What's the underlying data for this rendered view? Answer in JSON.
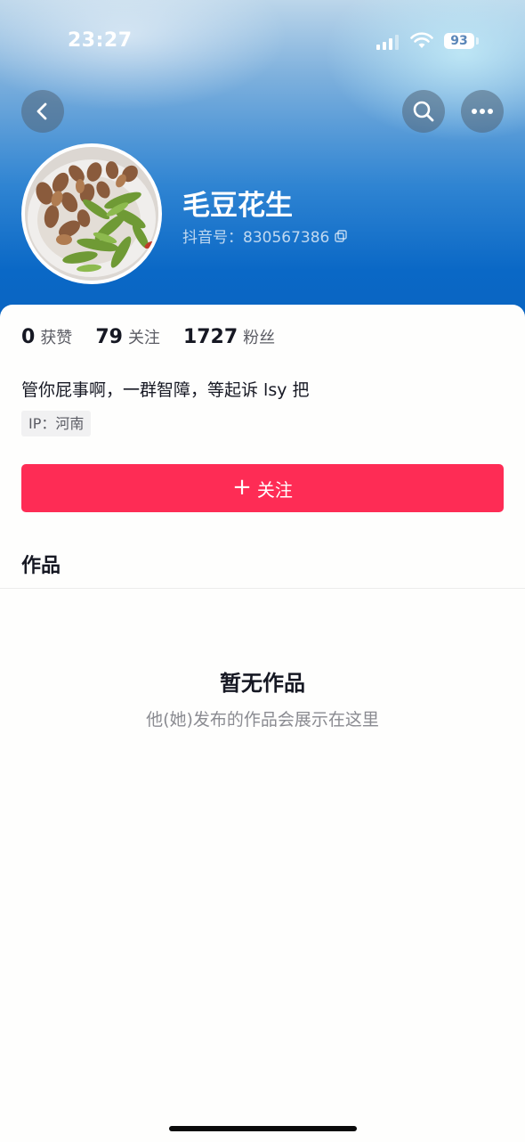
{
  "status_bar": {
    "time": "23:27",
    "battery": "93"
  },
  "profile": {
    "nickname": "毛豆花生",
    "douyin_id": "抖音号：830567386",
    "bio": "管你屁事啊，一群智障，等起诉 lsy 把",
    "ip": "IP：河南"
  },
  "stats": [
    {
      "value": "0",
      "label": "获赞"
    },
    {
      "value": "79",
      "label": "关注"
    },
    {
      "value": "1727",
      "label": "粉丝"
    }
  ],
  "actions": {
    "follow_label": "关注",
    "follow_icon": "+"
  },
  "tabs": {
    "works": "作品"
  },
  "empty_state": {
    "title": "暂无作品",
    "subtitle": "他(她)发布的作品会展示在这里"
  },
  "colors": {
    "accent": "#fe2c55",
    "header": "#0a68c6"
  }
}
